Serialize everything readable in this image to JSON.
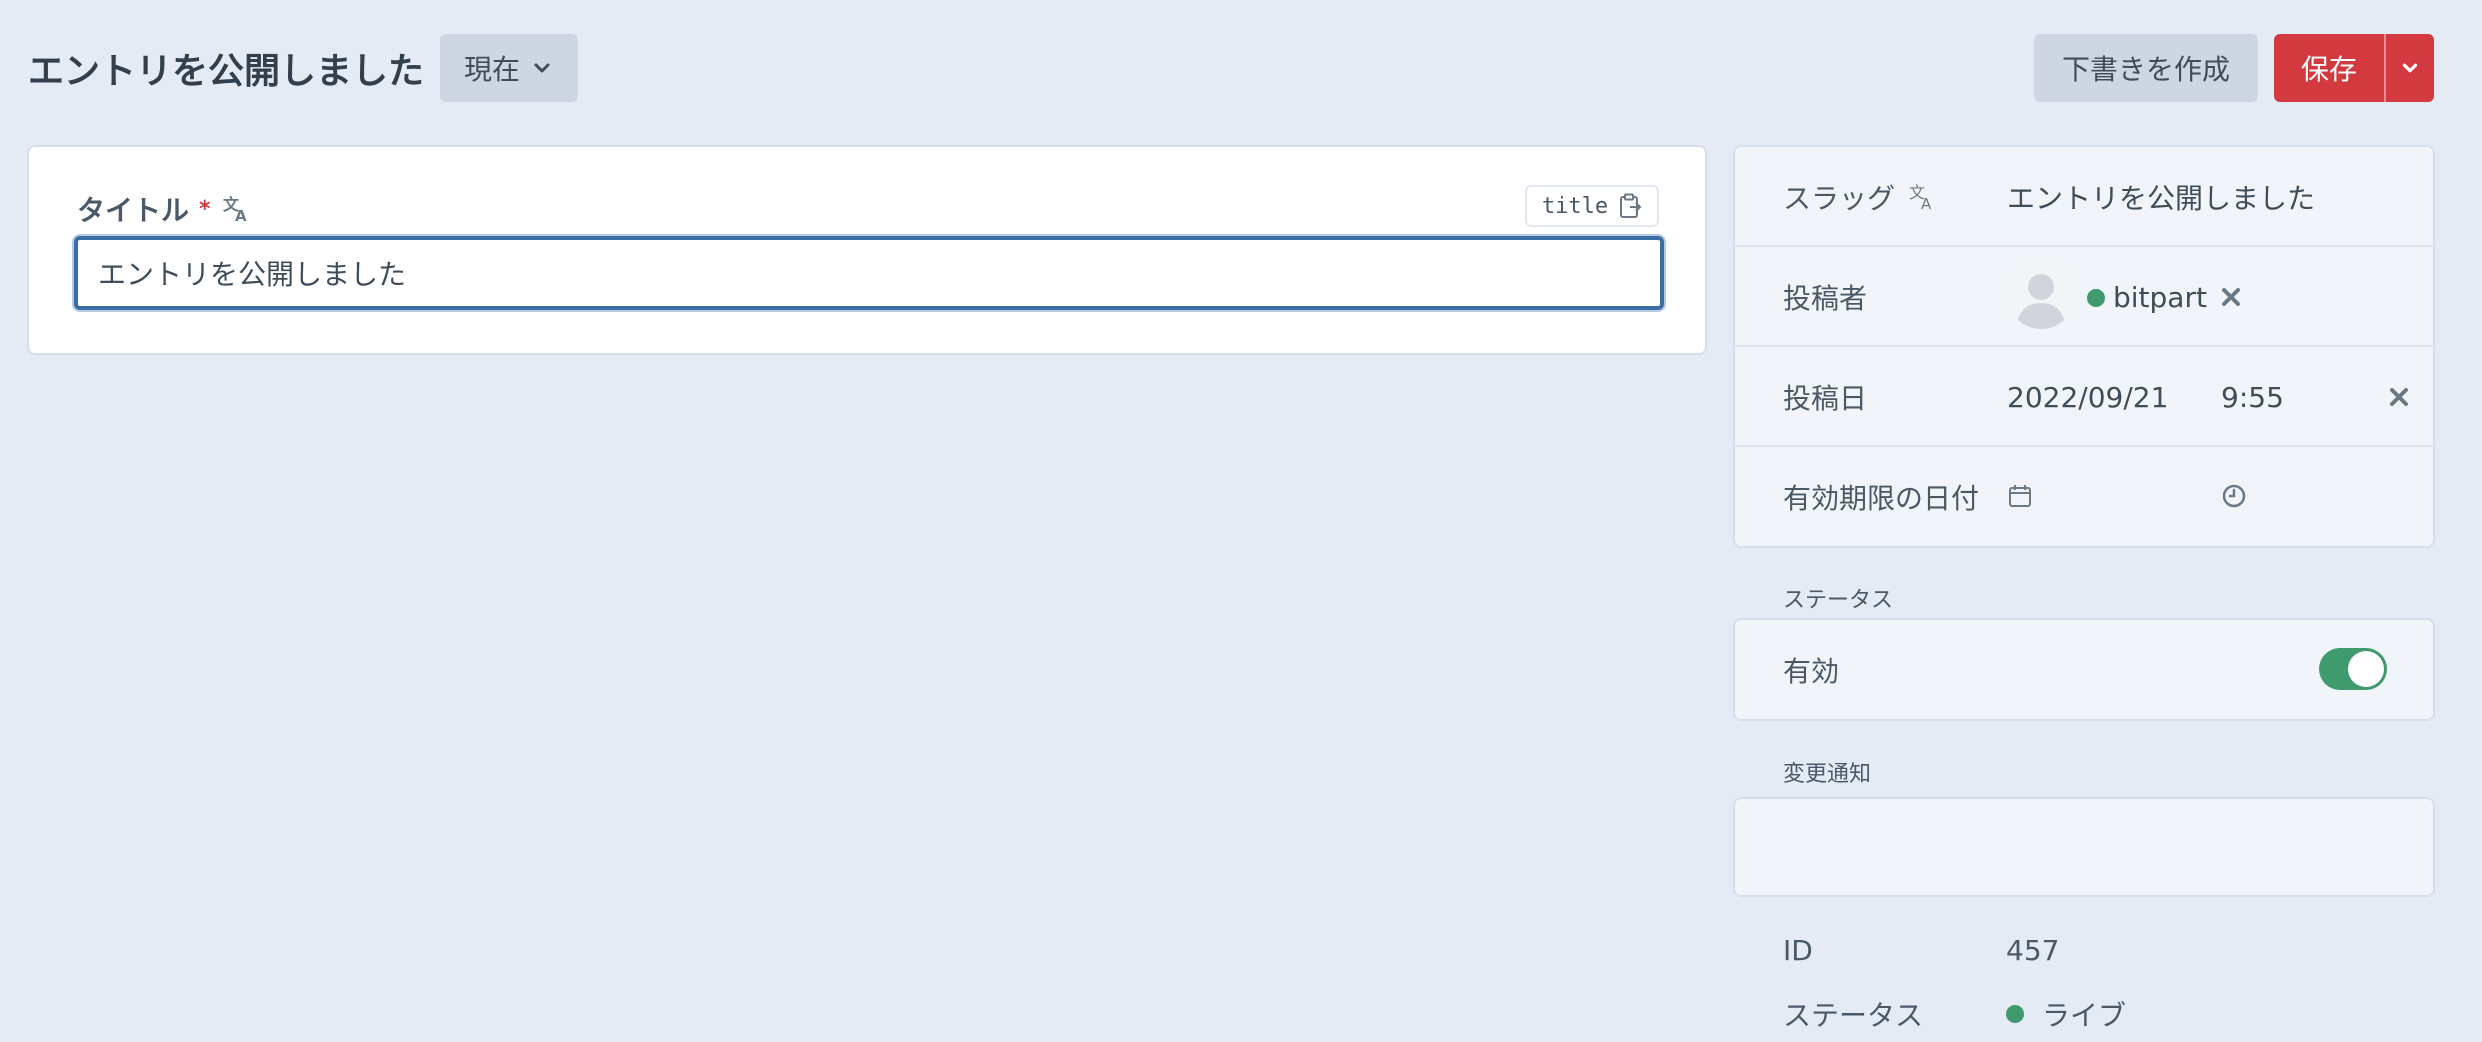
{
  "header": {
    "title": "エントリを公開しました",
    "site_selector_label": "現在",
    "draft_button_label": "下書きを作成",
    "save_button_label": "保存"
  },
  "main": {
    "title_field": {
      "label": "タイトル",
      "required_mark": "*",
      "handle": "title",
      "value": "エントリを公開しました"
    }
  },
  "sidebar": {
    "slug": {
      "label": "スラッグ",
      "value": "エントリを公開しました"
    },
    "author": {
      "label": "投稿者",
      "name": "bitpart",
      "online": true
    },
    "post_date": {
      "label": "投稿日",
      "date": "2022/09/21",
      "time": "9:55"
    },
    "expiry_date": {
      "label": "有効期限の日付",
      "date": "",
      "time": ""
    },
    "status_section_label": "ステータス",
    "enabled": {
      "label": "有効",
      "on": true
    },
    "notifications_section_label": "変更通知",
    "id": {
      "label": "ID",
      "value": "457"
    },
    "status": {
      "label": "ステータス",
      "value": "ライブ"
    }
  },
  "colors": {
    "background": "#e4ebf5",
    "primary_red": "#d33a3f",
    "focus_blue": "#3b6ea5",
    "success_green": "#3f9a6e"
  },
  "icons": {
    "translate": "translate-icon",
    "clipboard": "clipboard-icon",
    "chevron": "chevron-down-icon",
    "close": "close-icon",
    "calendar": "calendar-icon",
    "clock": "clock-icon",
    "avatar": "user-avatar"
  }
}
